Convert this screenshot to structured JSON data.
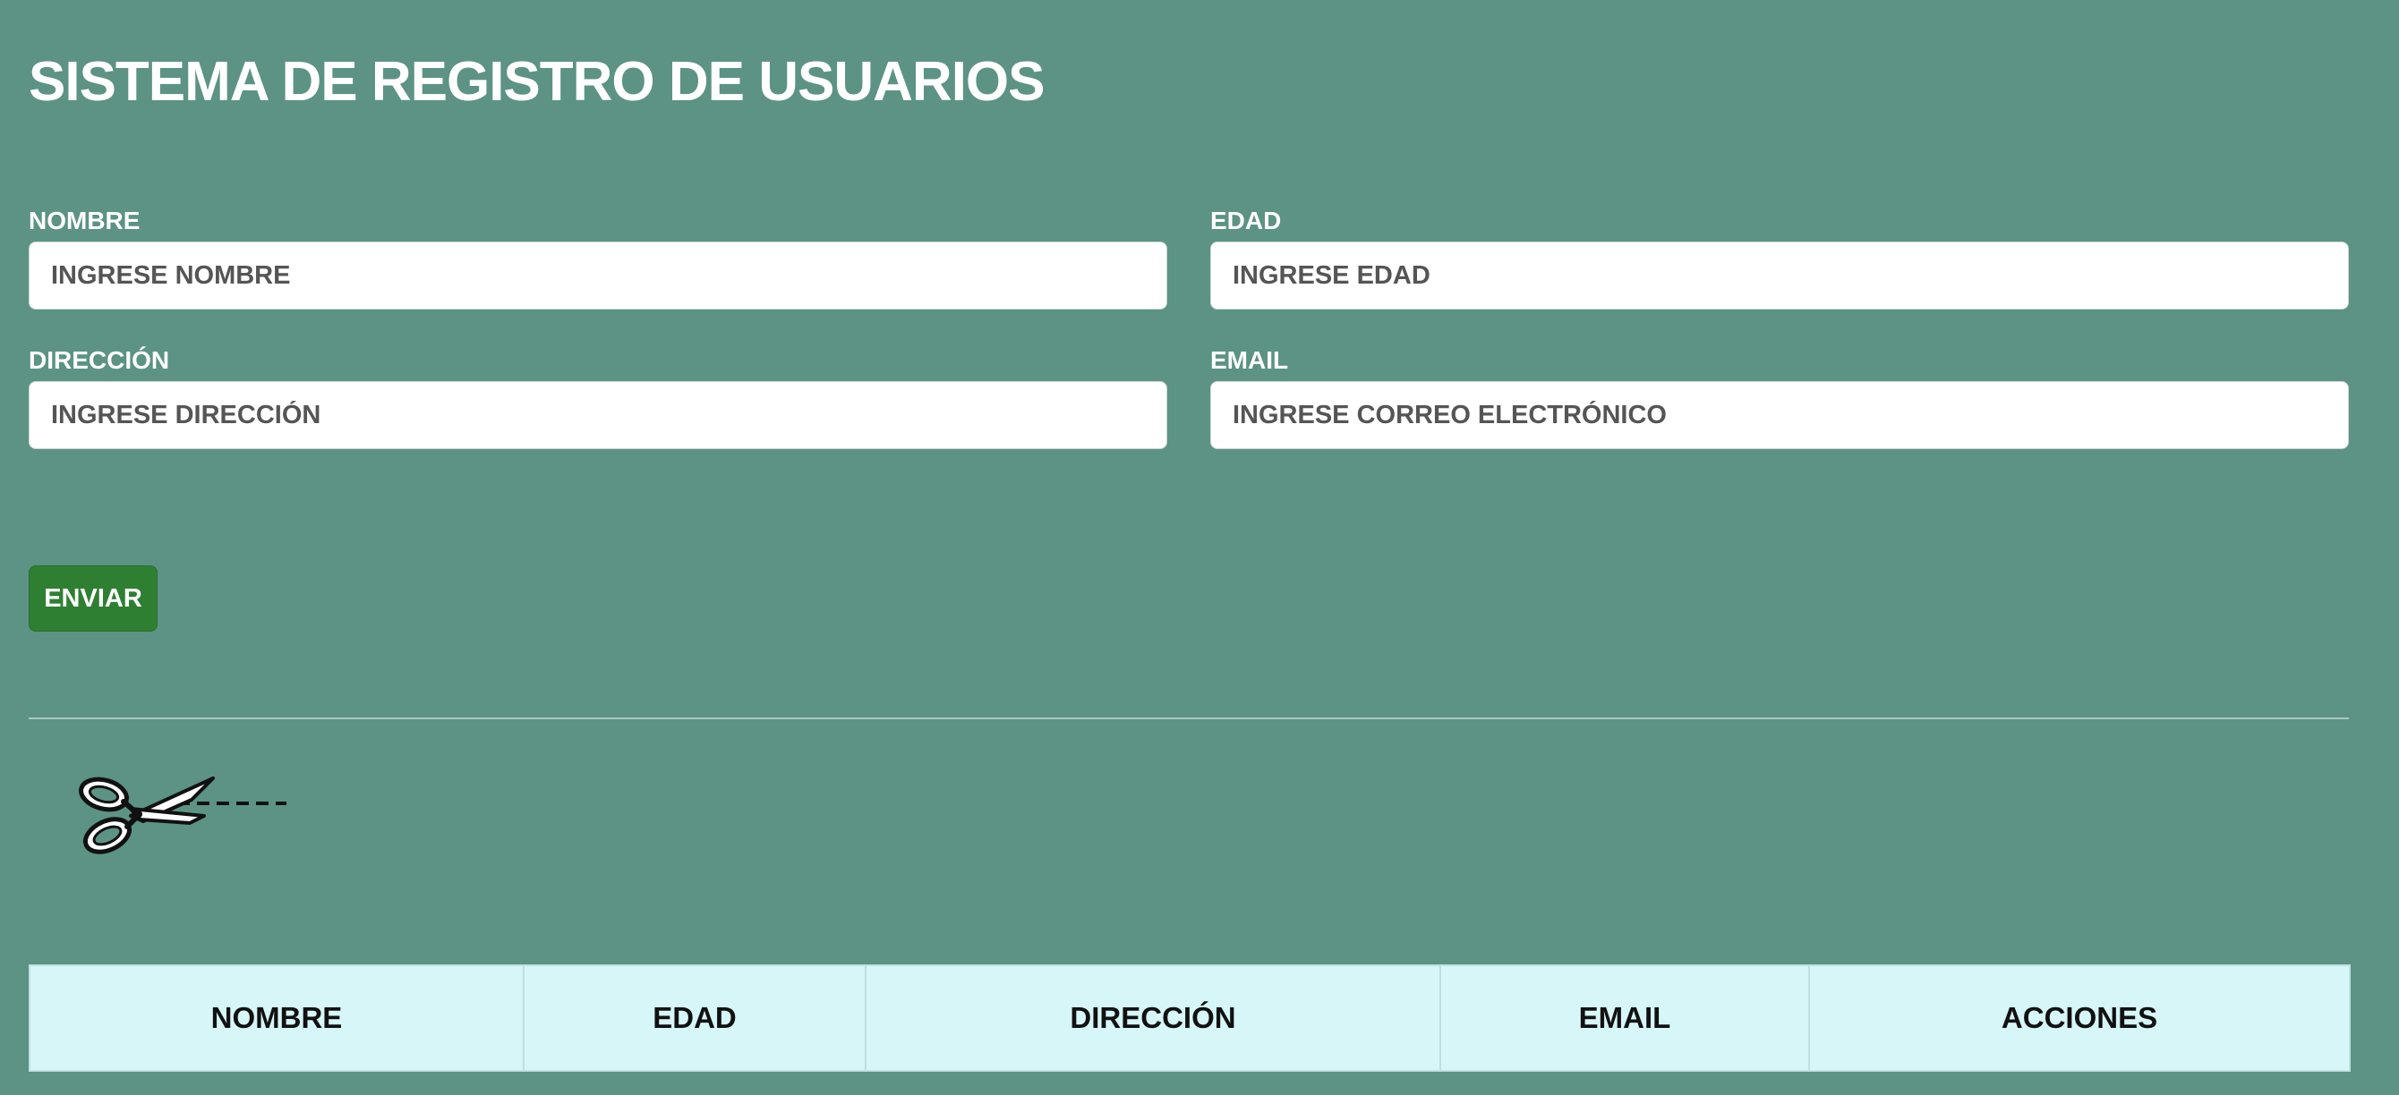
{
  "header": {
    "title": "SISTEMA DE REGISTRO DE USUARIOS"
  },
  "form": {
    "nombre": {
      "label": "NOMBRE",
      "placeholder": "INGRESE NOMBRE"
    },
    "edad": {
      "label": "EDAD",
      "placeholder": "INGRESE EDAD"
    },
    "direccion": {
      "label": "DIRECCIÓN",
      "placeholder": "INGRESE DIRECCIÓN"
    },
    "email": {
      "label": "EMAIL",
      "placeholder": "INGRESE CORREO ELECTRÓNICO"
    },
    "submit_label": "ENVIAR"
  },
  "decoration": {
    "icon": "scissors-icon"
  },
  "table": {
    "headers": [
      "NOMBRE",
      "EDAD",
      "DIRECCIÓN",
      "EMAIL",
      "ACCIONES"
    ],
    "rows": []
  },
  "colors": {
    "background": "#5c9384",
    "submit_button": "#2f7f33",
    "table_header": "#d6f6f8"
  }
}
